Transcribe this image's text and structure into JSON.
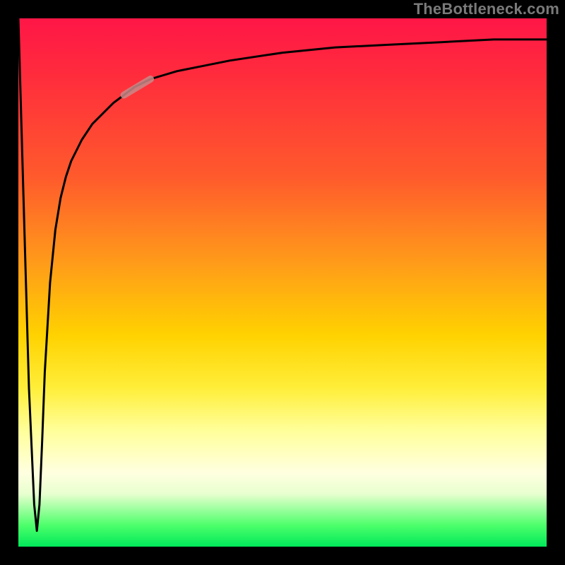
{
  "watermark": "TheBottleneck.com",
  "chart_data": {
    "type": "line",
    "title": "",
    "xlabel": "",
    "ylabel": "",
    "xlim": [
      0,
      100
    ],
    "ylim": [
      0,
      100
    ],
    "grid": false,
    "legend": false,
    "background_gradient": {
      "direction": "vertical",
      "stops": [
        {
          "pos": 0.0,
          "color": "#ff1647"
        },
        {
          "pos": 0.3,
          "color": "#ff5a2c"
        },
        {
          "pos": 0.6,
          "color": "#ffd200"
        },
        {
          "pos": 0.86,
          "color": "#ffffe0"
        },
        {
          "pos": 1.0,
          "color": "#00e85a"
        }
      ]
    },
    "series": [
      {
        "name": "curve",
        "color": "#000000",
        "x": [
          0,
          1,
          2,
          3,
          3.5,
          4,
          4.5,
          5,
          6,
          7,
          8,
          9,
          10,
          12,
          14,
          16,
          18,
          20,
          22,
          25,
          30,
          35,
          40,
          50,
          60,
          70,
          80,
          90,
          100
        ],
        "y": [
          100,
          65,
          30,
          8,
          3,
          8,
          20,
          33,
          50,
          60,
          66,
          70,
          73,
          77,
          80,
          82,
          84,
          85.5,
          87,
          88.5,
          90,
          91,
          92,
          93.5,
          94.5,
          95,
          95.5,
          96,
          96
        ]
      },
      {
        "name": "highlight-segment",
        "color": "#c88a88",
        "thickness": 10,
        "x": [
          20,
          25
        ],
        "y": [
          85.5,
          88.5
        ]
      }
    ],
    "annotations": []
  }
}
